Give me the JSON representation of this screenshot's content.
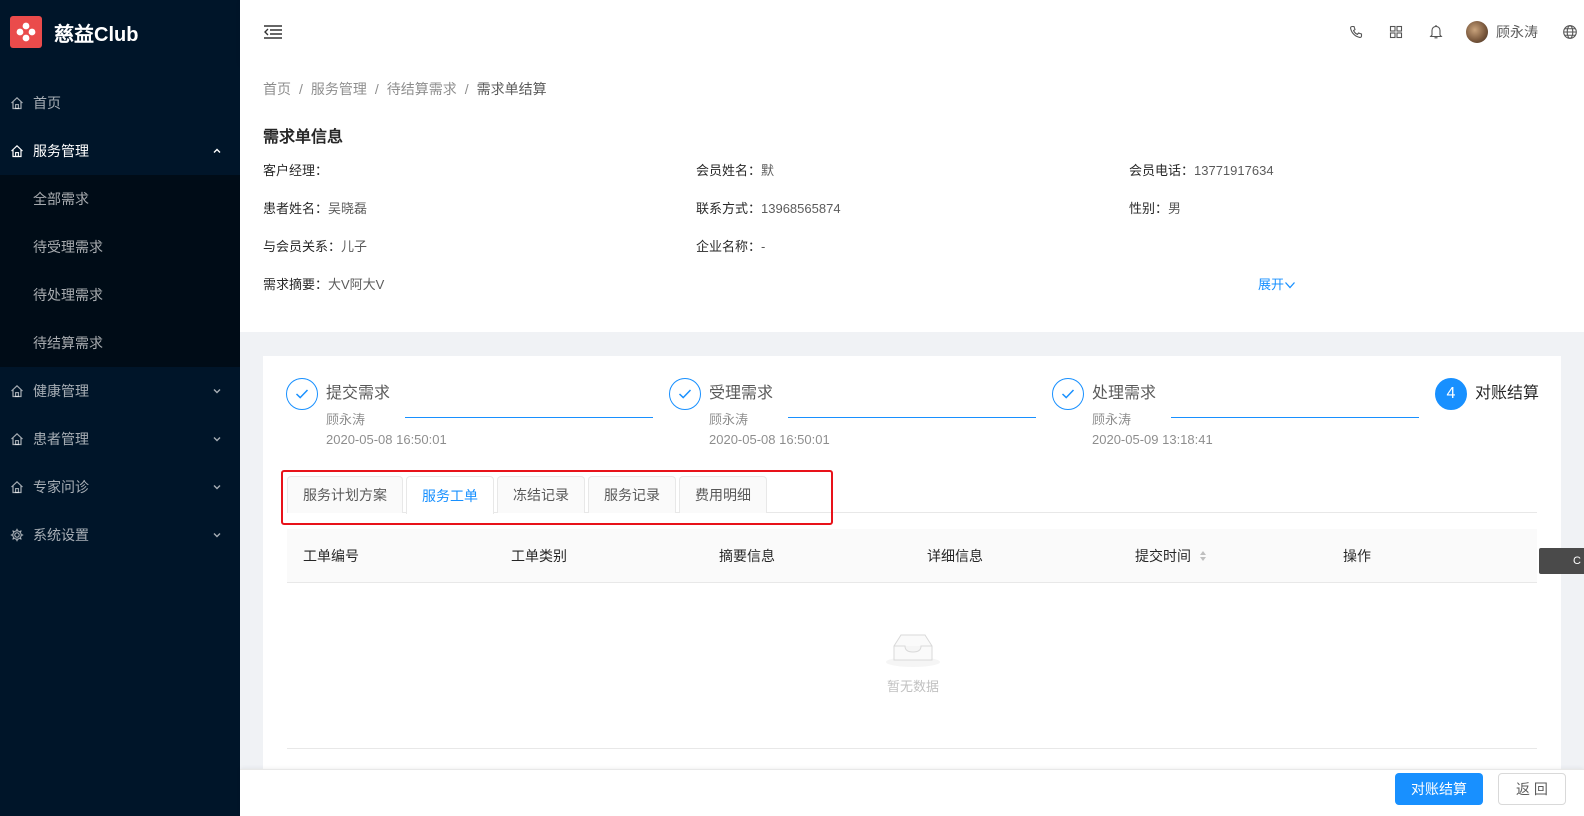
{
  "app": {
    "name": "慈益Club"
  },
  "sidebar": {
    "items": [
      {
        "label": "首页",
        "icon": "home-icon"
      },
      {
        "label": "服务管理",
        "icon": "home-icon",
        "open": true,
        "children": [
          "全部需求",
          "待受理需求",
          "待处理需求",
          "待结算需求"
        ]
      },
      {
        "label": "健康管理",
        "icon": "home-icon"
      },
      {
        "label": "患者管理",
        "icon": "home-icon"
      },
      {
        "label": "专家问诊",
        "icon": "home-icon"
      },
      {
        "label": "系统设置",
        "icon": "gear-icon"
      }
    ]
  },
  "header": {
    "icons": [
      "phone-icon",
      "grid-icon",
      "bell-icon",
      "globe-icon"
    ],
    "user_name": "顾永涛"
  },
  "breadcrumb": [
    "首页",
    "服务管理",
    "待结算需求",
    "需求单结算"
  ],
  "page_title": "需求单信息",
  "info": {
    "manager_label": "客户经理：",
    "manager_value": "",
    "member_name_label": "会员姓名：",
    "member_name_value": "默",
    "member_phone_label": "会员电话：",
    "member_phone_value": "13771917634",
    "patient_name_label": "患者姓名：",
    "patient_name_value": "吴晓磊",
    "contact_label": "联系方式：",
    "contact_value": "13968565874",
    "gender_label": "性别：",
    "gender_value": "男",
    "relation_label": "与会员关系：",
    "relation_value": "儿子",
    "company_label": "企业名称：",
    "company_value": "-",
    "summary_label": "需求摘要：",
    "summary_value": "大V阿大V",
    "expand_label": "展开"
  },
  "steps": [
    {
      "title": "提交需求",
      "person": "顾永涛",
      "time": "2020-05-08 16:50:01",
      "status": "finish"
    },
    {
      "title": "受理需求",
      "person": "顾永涛",
      "time": "2020-05-08 16:50:01",
      "status": "finish"
    },
    {
      "title": "处理需求",
      "person": "顾永涛",
      "time": "2020-05-09 13:18:41",
      "status": "finish"
    },
    {
      "title": "对账结算",
      "number": "4",
      "status": "process"
    }
  ],
  "tabs": [
    "服务计划方案",
    "服务工单",
    "冻结记录",
    "服务记录",
    "费用明细"
  ],
  "active_tab": "服务工单",
  "table": {
    "columns": [
      "工单编号",
      "工单类别",
      "摘要信息",
      "详细信息",
      "提交时间",
      "操作"
    ],
    "empty_text": "暂无数据"
  },
  "side_tab_text": "C",
  "footer": {
    "primary": "对账结算",
    "back": "返 回"
  },
  "colors": {
    "primary": "#1890ff",
    "sidebar": "#001529",
    "highlight_box": "#e8121a",
    "logo": "#ea4b4b"
  }
}
